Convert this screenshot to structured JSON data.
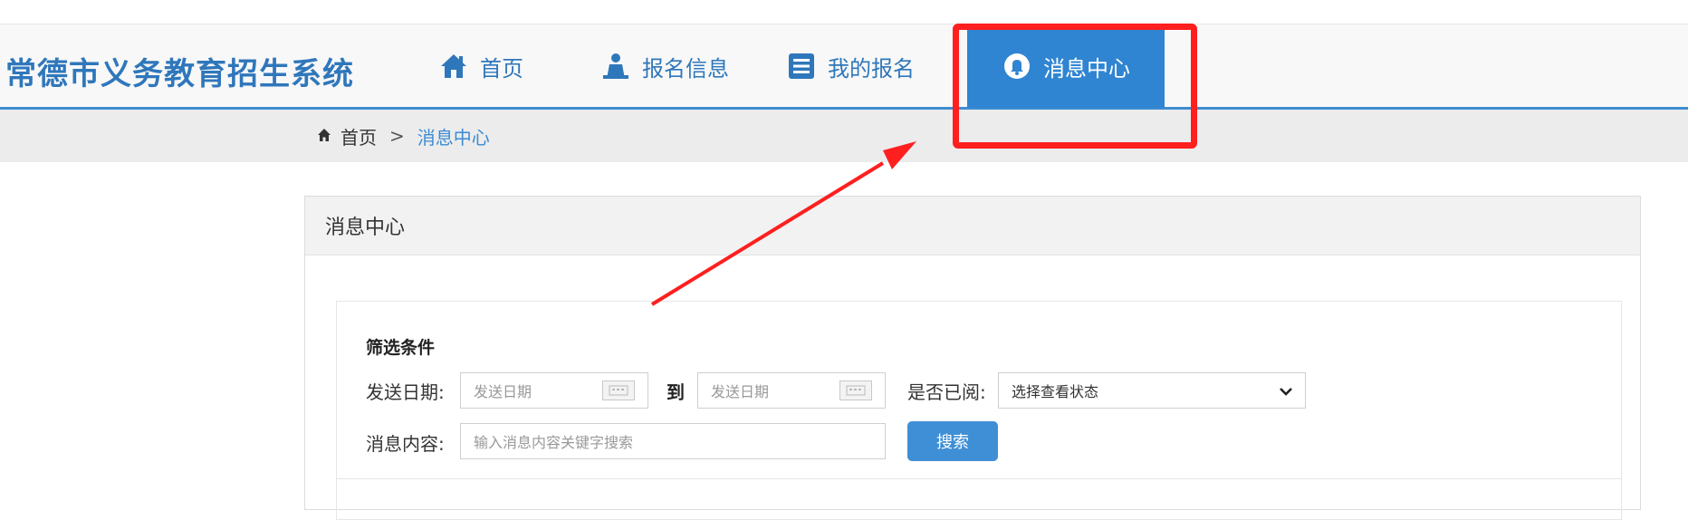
{
  "header": {
    "logo": "常德市义务教育招生系统",
    "nav": [
      {
        "label": "首页",
        "icon": "home-icon"
      },
      {
        "label": "报名信息",
        "icon": "person-icon"
      },
      {
        "label": "我的报名",
        "icon": "list-icon"
      },
      {
        "label": "消息中心",
        "icon": "bell-icon",
        "active": true
      }
    ],
    "accent_color": "#2f85d1"
  },
  "breadcrumb": {
    "home": "首页",
    "separator": ">",
    "current": "消息中心"
  },
  "panel": {
    "title": "消息中心",
    "filter": {
      "title": "筛选条件",
      "send_date_label": "发送日期:",
      "date_from_placeholder": "发送日期",
      "to_label": "到",
      "date_to_placeholder": "发送日期",
      "read_label": "是否已阅:",
      "read_select_value": "选择查看状态",
      "content_label": "消息内容:",
      "content_placeholder": "输入消息内容关键字搜索",
      "search_button": "搜索"
    }
  },
  "annotation": {
    "highlight_color": "#ff1f1f"
  }
}
